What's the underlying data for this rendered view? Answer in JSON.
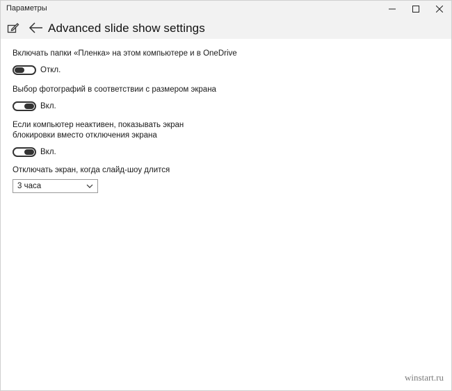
{
  "window": {
    "title": "Параметры",
    "controls": {
      "minimize": "—",
      "maximize": "☐",
      "close": "✕"
    }
  },
  "header": {
    "title": "Advanced slide show settings",
    "icons": [
      "edit-icon",
      "back-arrow-icon"
    ]
  },
  "settings": [
    {
      "label": "Включать папки «Пленка» на этом компьютере и в OneDrive",
      "state": "Откл.",
      "on": false
    },
    {
      "label": "Выбор фотографий в соответствии с размером экрана",
      "state": "Вкл.",
      "on": true
    },
    {
      "label": "Если компьютер неактивен, показывать экран блокировки вместо отключения экрана",
      "state": "Вкл.",
      "on": true
    }
  ],
  "screen_off": {
    "label": "Отключать экран, когда слайд-шоу длится",
    "selected": "3 часа"
  },
  "watermark": "winstart.ru"
}
